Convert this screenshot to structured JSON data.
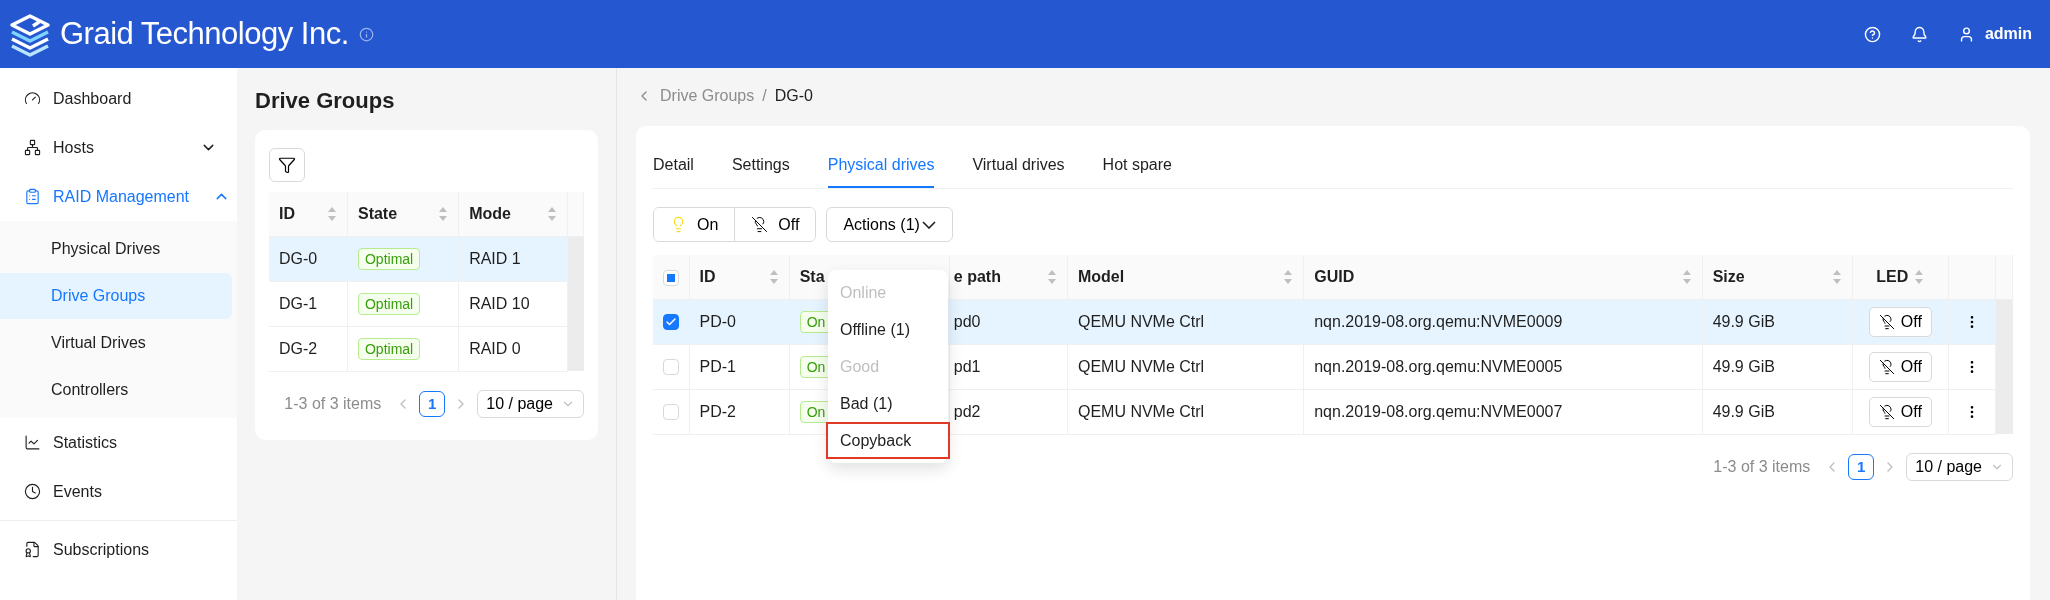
{
  "header": {
    "brand": "Graid Technology Inc.",
    "user": "admin"
  },
  "sidebar": {
    "items": [
      {
        "label": "Dashboard",
        "selected": false
      },
      {
        "label": "Hosts",
        "expanded": false,
        "selected": false
      },
      {
        "label": "RAID Management",
        "expanded": true,
        "selected": true,
        "children": [
          {
            "label": "Physical Drives",
            "selected": false
          },
          {
            "label": "Drive Groups",
            "selected": true
          },
          {
            "label": "Virtual Drives",
            "selected": false
          },
          {
            "label": "Controllers",
            "selected": false
          }
        ]
      },
      {
        "label": "Statistics",
        "selected": false
      },
      {
        "label": "Events",
        "selected": false
      },
      {
        "label": "Subscriptions",
        "selected": false
      }
    ]
  },
  "group_list": {
    "title": "Drive Groups",
    "columns": [
      "ID",
      "State",
      "Mode"
    ],
    "rows": [
      {
        "id": "DG-0",
        "state": "Optimal",
        "mode": "RAID 1",
        "selected": true
      },
      {
        "id": "DG-1",
        "state": "Optimal",
        "mode": "RAID 10",
        "selected": false
      },
      {
        "id": "DG-2",
        "state": "Optimal",
        "mode": "RAID 0",
        "selected": false
      }
    ],
    "pagination": {
      "summary": "1-3 of 3 items",
      "page": "1",
      "page_size": "10 / page"
    }
  },
  "breadcrumb": {
    "parent": "Drive Groups",
    "separator": "/",
    "current": "DG-0"
  },
  "tabs": [
    {
      "label": "Detail",
      "selected": false
    },
    {
      "label": "Settings",
      "selected": false
    },
    {
      "label": "Physical drives",
      "selected": true
    },
    {
      "label": "Virtual drives",
      "selected": false
    },
    {
      "label": "Hot spare",
      "selected": false
    }
  ],
  "toolbar": {
    "led_on": "On",
    "led_off": "Off",
    "actions": "Actions (1)"
  },
  "actions_menu": [
    {
      "label": "Online",
      "disabled": true,
      "highlighted": false
    },
    {
      "label": "Offline (1)",
      "disabled": false,
      "highlighted": false
    },
    {
      "label": "Good",
      "disabled": true,
      "highlighted": false
    },
    {
      "label": "Bad (1)",
      "disabled": false,
      "highlighted": false
    },
    {
      "label": "Copyback",
      "disabled": false,
      "highlighted": true
    }
  ],
  "drives": {
    "select_all": {
      "indeterminate": true
    },
    "columns": [
      "ID",
      "Sta",
      "e path",
      "Model",
      "GUID",
      "Size",
      "LED"
    ],
    "rows": [
      {
        "id": "PD-0",
        "state": "On",
        "path": "pd0",
        "model": "QEMU NVMe Ctrl",
        "guid": "nqn.2019-08.org.qemu:NVME0009",
        "size": "49.9 GiB",
        "led": "Off",
        "checked": true,
        "selected": true
      },
      {
        "id": "PD-1",
        "state": "On",
        "path": "pd1",
        "model": "QEMU NVMe Ctrl",
        "guid": "nqn.2019-08.org.qemu:NVME0005",
        "size": "49.9 GiB",
        "led": "Off",
        "checked": false,
        "selected": false
      },
      {
        "id": "PD-2",
        "state": "On",
        "path": "pd2",
        "model": "QEMU NVMe Ctrl",
        "guid": "nqn.2019-08.org.qemu:NVME0007",
        "size": "49.9 GiB",
        "led": "Off",
        "checked": false,
        "selected": false
      }
    ],
    "pagination": {
      "summary": "1-3 of 3 items",
      "page": "1",
      "page_size": "10 / page"
    }
  }
}
